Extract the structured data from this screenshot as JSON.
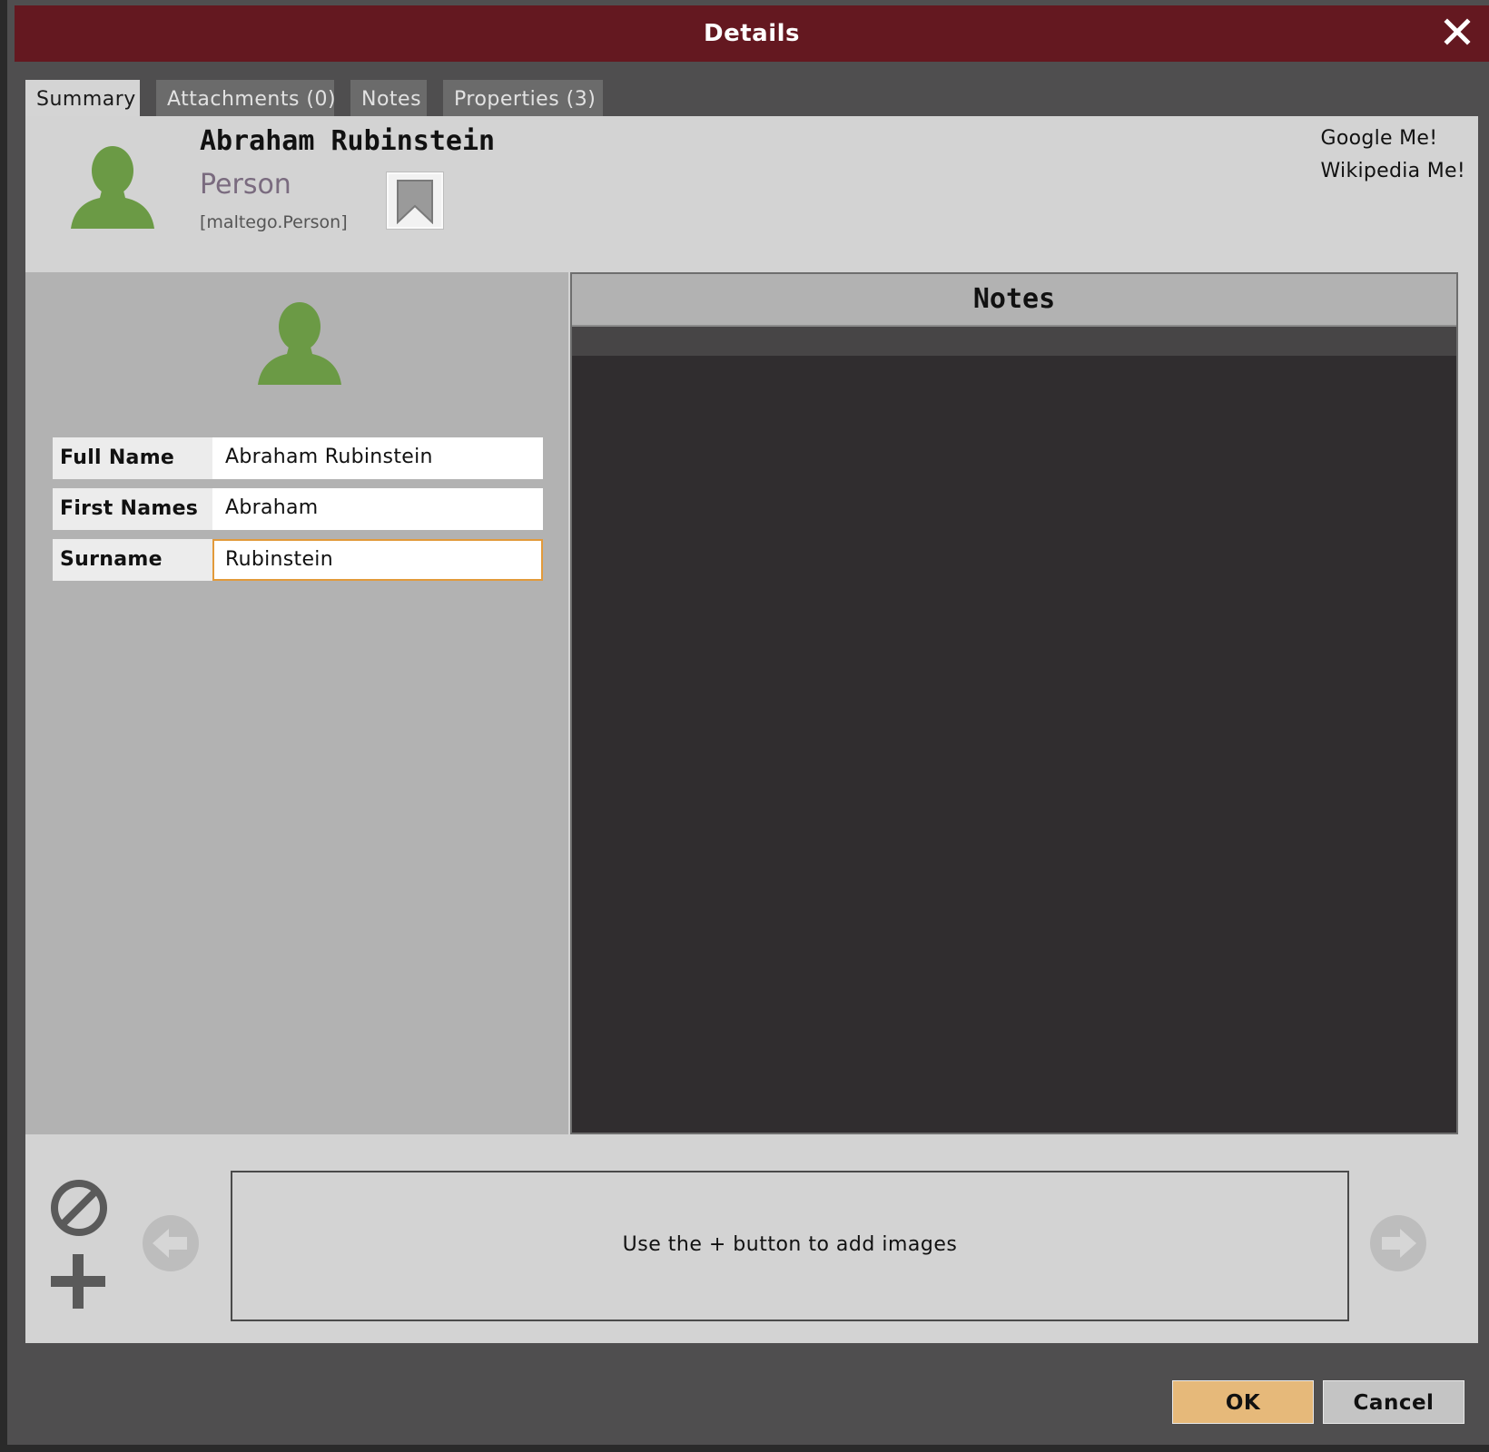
{
  "window": {
    "title": "Details"
  },
  "tabs": [
    {
      "label": "Summary"
    },
    {
      "label": "Attachments (0)"
    },
    {
      "label": "Notes"
    },
    {
      "label": "Properties (3)"
    }
  ],
  "entity": {
    "name": "Abraham Rubinstein",
    "type": "Person",
    "type_id": "[maltego.Person]"
  },
  "links": {
    "google": "Google Me!",
    "wikipedia": "Wikipedia Me!"
  },
  "properties": [
    {
      "label": "Full Name",
      "value": "Abraham Rubinstein"
    },
    {
      "label": "First Names",
      "value": "Abraham"
    },
    {
      "label": "Surname",
      "value": "Rubinstein"
    }
  ],
  "notes": {
    "title": "Notes"
  },
  "gallery": {
    "placeholder": "Use the + button to add images"
  },
  "buttons": {
    "ok": "OK",
    "cancel": "Cancel"
  },
  "colors": {
    "title_bar": "#641820",
    "person_icon": "#6b9a45",
    "ok_button": "#e6b97a",
    "focus_border": "#e29a3b"
  }
}
